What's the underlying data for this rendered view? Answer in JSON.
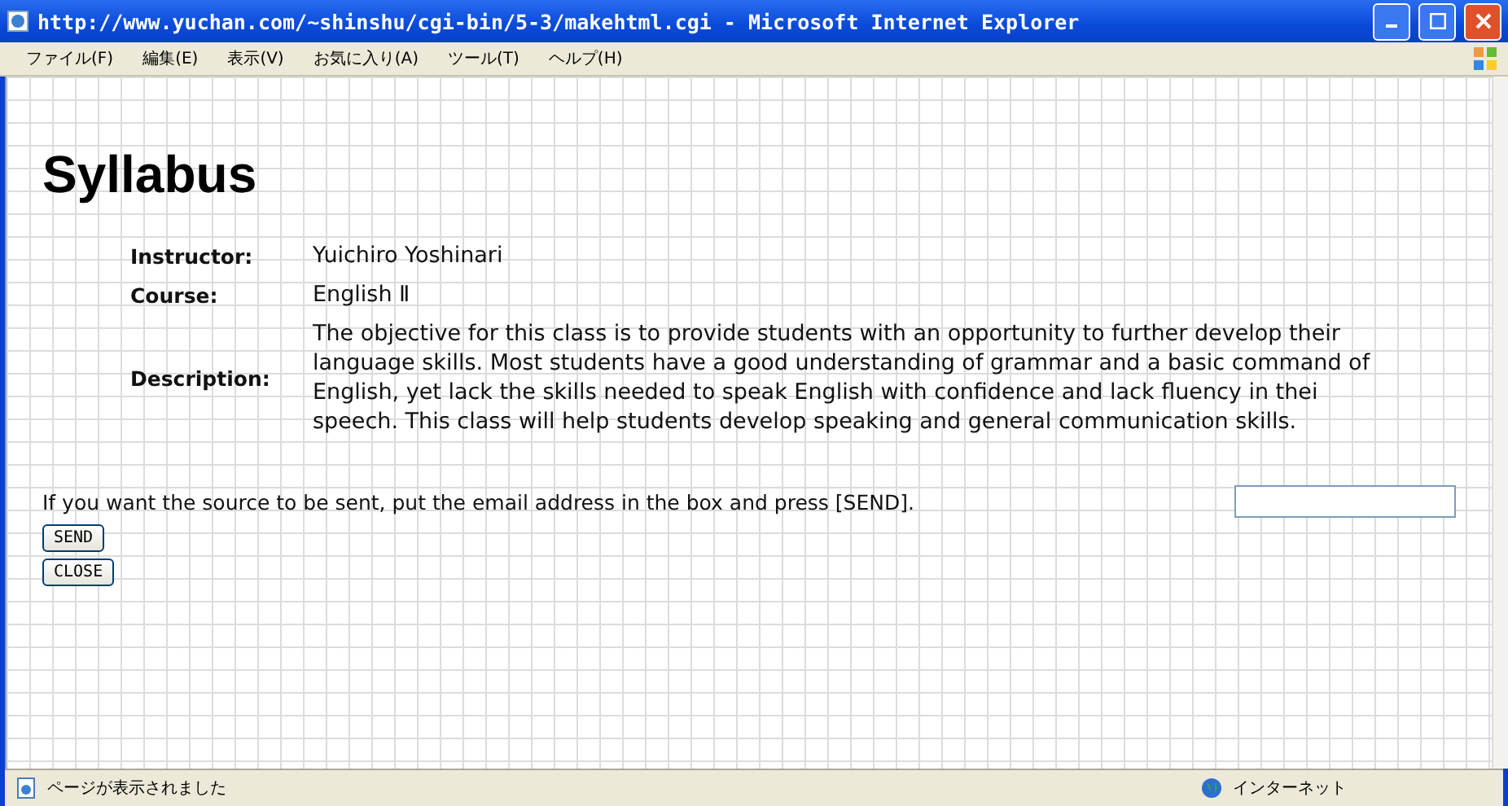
{
  "window": {
    "title": "http://www.yuchan.com/~shinshu/cgi-bin/5-3/makehtml.cgi - Microsoft Internet Explorer"
  },
  "menu": [
    "ファイル(F)",
    "編集(E)",
    "表示(V)",
    "お気に入り(A)",
    "ツール(T)",
    "ヘルプ(H)"
  ],
  "page": {
    "heading": "Syllabus",
    "details": [
      {
        "label": "Instructor:",
        "value": "Yuichiro Yoshinari"
      },
      {
        "label": "Course:",
        "value": "English Ⅱ"
      },
      {
        "label": "Description:",
        "value": "The objective for this class is to provide students with an opportunity to further develop their language skills. Most students have a good understanding of grammar and a basic command of English, yet lack the skills needed to speak English with confidence and lack fluency in thei speech. This class will help students develop speaking and general communication skills."
      }
    ],
    "send_prompt": "If you want the source to be sent, put the email address in the box and press [SEND].",
    "buttons": [
      "SEND",
      "CLOSE"
    ]
  },
  "status_bar": {
    "message": "ページが表示されました",
    "zone": "インターネット"
  }
}
